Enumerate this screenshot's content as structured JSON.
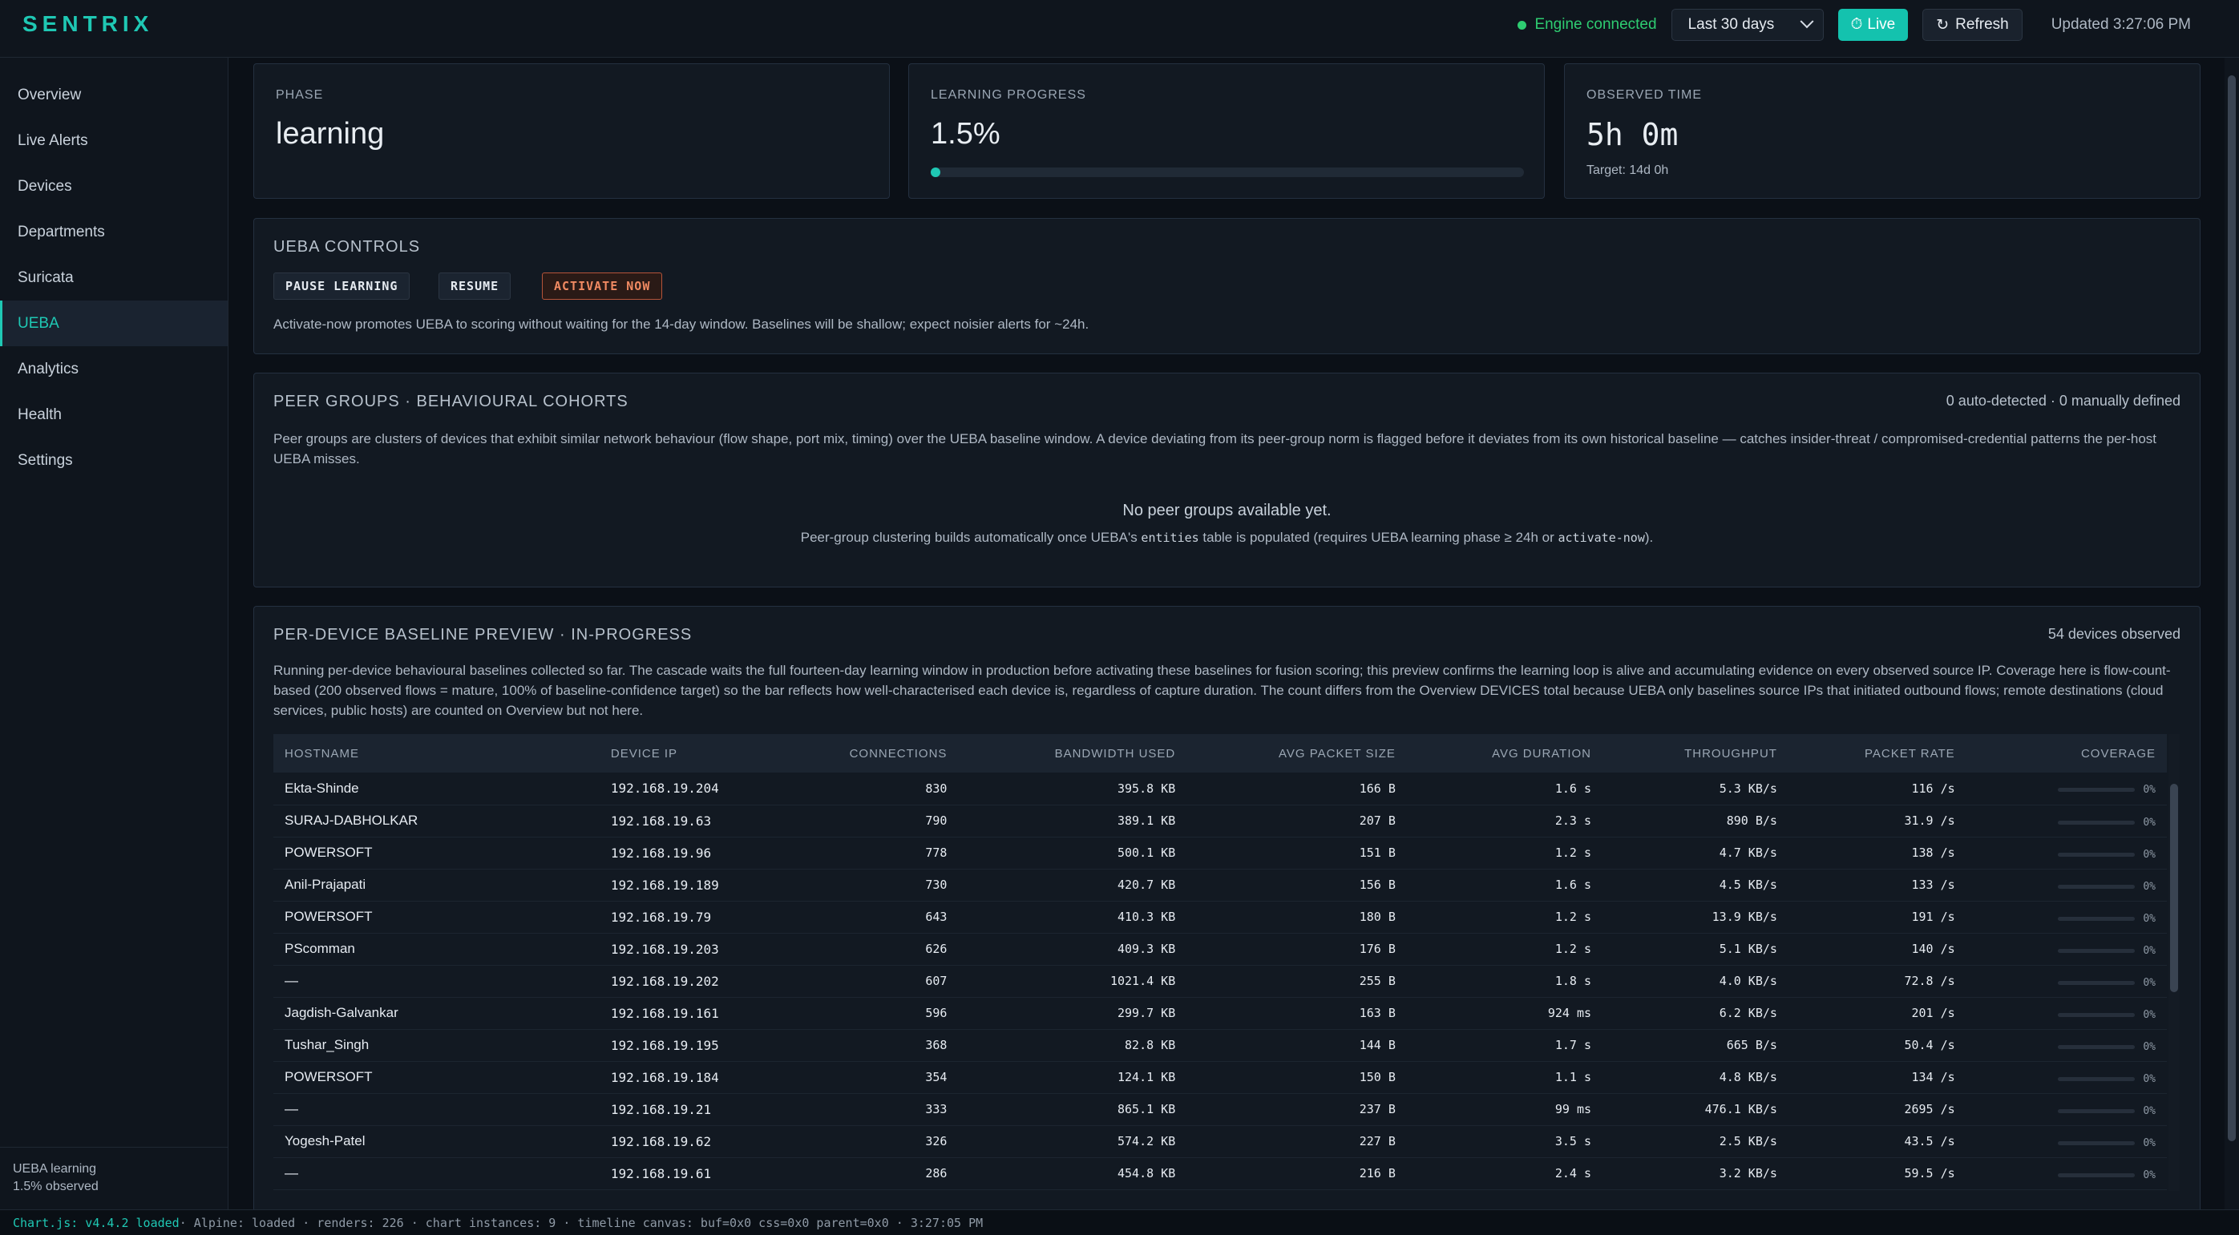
{
  "brand": "SENTRIX",
  "header": {
    "engine_status": "Engine connected",
    "range": "Last 30 days",
    "live_label": "Live",
    "refresh_label": "Refresh",
    "updated": "Updated 3:27:06 PM",
    "colors": {
      "accent": "#1fc8b4",
      "connected": "#2ecc71"
    }
  },
  "sidebar": {
    "items": [
      {
        "label": "Overview"
      },
      {
        "label": "Live Alerts"
      },
      {
        "label": "Devices"
      },
      {
        "label": "Departments"
      },
      {
        "label": "Suricata"
      },
      {
        "label": "UEBA",
        "active": true
      },
      {
        "label": "Analytics"
      },
      {
        "label": "Health"
      },
      {
        "label": "Settings"
      }
    ],
    "footer_line1": "UEBA learning",
    "footer_line2": "1.5% observed"
  },
  "kpis": {
    "phase": {
      "label": "PHASE",
      "value": "learning"
    },
    "progress": {
      "label": "LEARNING PROGRESS",
      "value": "1.5%",
      "fraction": 0.015
    },
    "observed": {
      "label": "OBSERVED TIME",
      "value": "5h 0m",
      "sub": "Target: 14d 0h"
    }
  },
  "controls": {
    "title": "UEBA CONTROLS",
    "pause": "PAUSE LEARNING",
    "resume": "RESUME",
    "activate": "ACTIVATE NOW",
    "note": "Activate-now promotes UEBA to scoring without waiting for the 14-day window. Baselines will be shallow; expect noisier alerts for ~24h."
  },
  "peer_groups": {
    "title": "PEER GROUPS · BEHAVIOURAL COHORTS",
    "counts": "0 auto-detected · 0 manually defined",
    "desc": "Peer groups are clusters of devices that exhibit similar network behaviour (flow shape, port mix, timing) over the UEBA baseline window. A device deviating from its peer-group norm is flagged before it deviates from its own historical baseline — catches insider-threat / compromised-credential patterns the per-host UEBA misses.",
    "empty_title": "No peer groups available yet.",
    "empty_pre": "Peer-group clustering builds automatically once UEBA's ",
    "empty_code1": "entities",
    "empty_mid": " table is populated (requires UEBA learning phase ≥ 24h or ",
    "empty_code2": "activate-now",
    "empty_post": ")."
  },
  "baseline": {
    "title": "PER-DEVICE BASELINE PREVIEW · IN-PROGRESS",
    "count": "54 devices observed",
    "desc": "Running per-device behavioural baselines collected so far. The cascade waits the full fourteen-day learning window in production before activating these baselines for fusion scoring; this preview confirms the learning loop is alive and accumulating evidence on every observed source IP. Coverage here is flow-count-based (200 observed flows = mature, 100% of baseline-confidence target) so the bar reflects how well-characterised each device is, regardless of capture duration. The count differs from the Overview DEVICES total because UEBA only baselines source IPs that initiated outbound flows; remote destinations (cloud services, public hosts) are counted on Overview but not here.",
    "columns": [
      "HOSTNAME",
      "DEVICE IP",
      "CONNECTIONS",
      "BANDWIDTH USED",
      "AVG PACKET SIZE",
      "AVG DURATION",
      "THROUGHPUT",
      "PACKET RATE",
      "COVERAGE"
    ],
    "rows": [
      {
        "host": "Ekta-Shinde",
        "ip": "192.168.19.204",
        "conn": "830",
        "bw": "395.8 KB",
        "pkt": "166 B",
        "dur": "1.6 s",
        "thr": "5.3 KB/s",
        "rate": "116 /s",
        "cov": "0%"
      },
      {
        "host": "SURAJ-DABHOLKAR",
        "ip": "192.168.19.63",
        "conn": "790",
        "bw": "389.1 KB",
        "pkt": "207 B",
        "dur": "2.3 s",
        "thr": "890 B/s",
        "rate": "31.9 /s",
        "cov": "0%"
      },
      {
        "host": "POWERSOFT",
        "ip": "192.168.19.96",
        "conn": "778",
        "bw": "500.1 KB",
        "pkt": "151 B",
        "dur": "1.2 s",
        "thr": "4.7 KB/s",
        "rate": "138 /s",
        "cov": "0%"
      },
      {
        "host": "Anil-Prajapati",
        "ip": "192.168.19.189",
        "conn": "730",
        "bw": "420.7 KB",
        "pkt": "156 B",
        "dur": "1.6 s",
        "thr": "4.5 KB/s",
        "rate": "133 /s",
        "cov": "0%"
      },
      {
        "host": "POWERSOFT",
        "ip": "192.168.19.79",
        "conn": "643",
        "bw": "410.3 KB",
        "pkt": "180 B",
        "dur": "1.2 s",
        "thr": "13.9 KB/s",
        "rate": "191 /s",
        "cov": "0%"
      },
      {
        "host": "PScomman",
        "ip": "192.168.19.203",
        "conn": "626",
        "bw": "409.3 KB",
        "pkt": "176 B",
        "dur": "1.2 s",
        "thr": "5.1 KB/s",
        "rate": "140 /s",
        "cov": "0%"
      },
      {
        "host": "—",
        "ip": "192.168.19.202",
        "conn": "607",
        "bw": "1021.4 KB",
        "pkt": "255 B",
        "dur": "1.8 s",
        "thr": "4.0 KB/s",
        "rate": "72.8 /s",
        "cov": "0%"
      },
      {
        "host": "Jagdish-Galvankar",
        "ip": "192.168.19.161",
        "conn": "596",
        "bw": "299.7 KB",
        "pkt": "163 B",
        "dur": "924 ms",
        "thr": "6.2 KB/s",
        "rate": "201 /s",
        "cov": "0%"
      },
      {
        "host": "Tushar_Singh",
        "ip": "192.168.19.195",
        "conn": "368",
        "bw": "82.8 KB",
        "pkt": "144 B",
        "dur": "1.7 s",
        "thr": "665 B/s",
        "rate": "50.4 /s",
        "cov": "0%"
      },
      {
        "host": "POWERSOFT",
        "ip": "192.168.19.184",
        "conn": "354",
        "bw": "124.1 KB",
        "pkt": "150 B",
        "dur": "1.1 s",
        "thr": "4.8 KB/s",
        "rate": "134 /s",
        "cov": "0%"
      },
      {
        "host": "—",
        "ip": "192.168.19.21",
        "conn": "333",
        "bw": "865.1 KB",
        "pkt": "237 B",
        "dur": "99 ms",
        "thr": "476.1 KB/s",
        "rate": "2695 /s",
        "cov": "0%"
      },
      {
        "host": "Yogesh-Patel",
        "ip": "192.168.19.62",
        "conn": "326",
        "bw": "574.2 KB",
        "pkt": "227 B",
        "dur": "3.5 s",
        "thr": "2.5 KB/s",
        "rate": "43.5 /s",
        "cov": "0%"
      },
      {
        "host": "—",
        "ip": "192.168.19.61",
        "conn": "286",
        "bw": "454.8 KB",
        "pkt": "216 B",
        "dur": "2.4 s",
        "thr": "3.2 KB/s",
        "rate": "59.5 /s",
        "cov": "0%"
      }
    ]
  },
  "statusbar": {
    "chartjs": "Chart.js: v4.4.2 loaded",
    "rest": " · Alpine: loaded · renders: 226 · chart instances: 9 · timeline canvas: buf=0x0 css=0x0 parent=0x0 · 3:27:05 PM"
  }
}
